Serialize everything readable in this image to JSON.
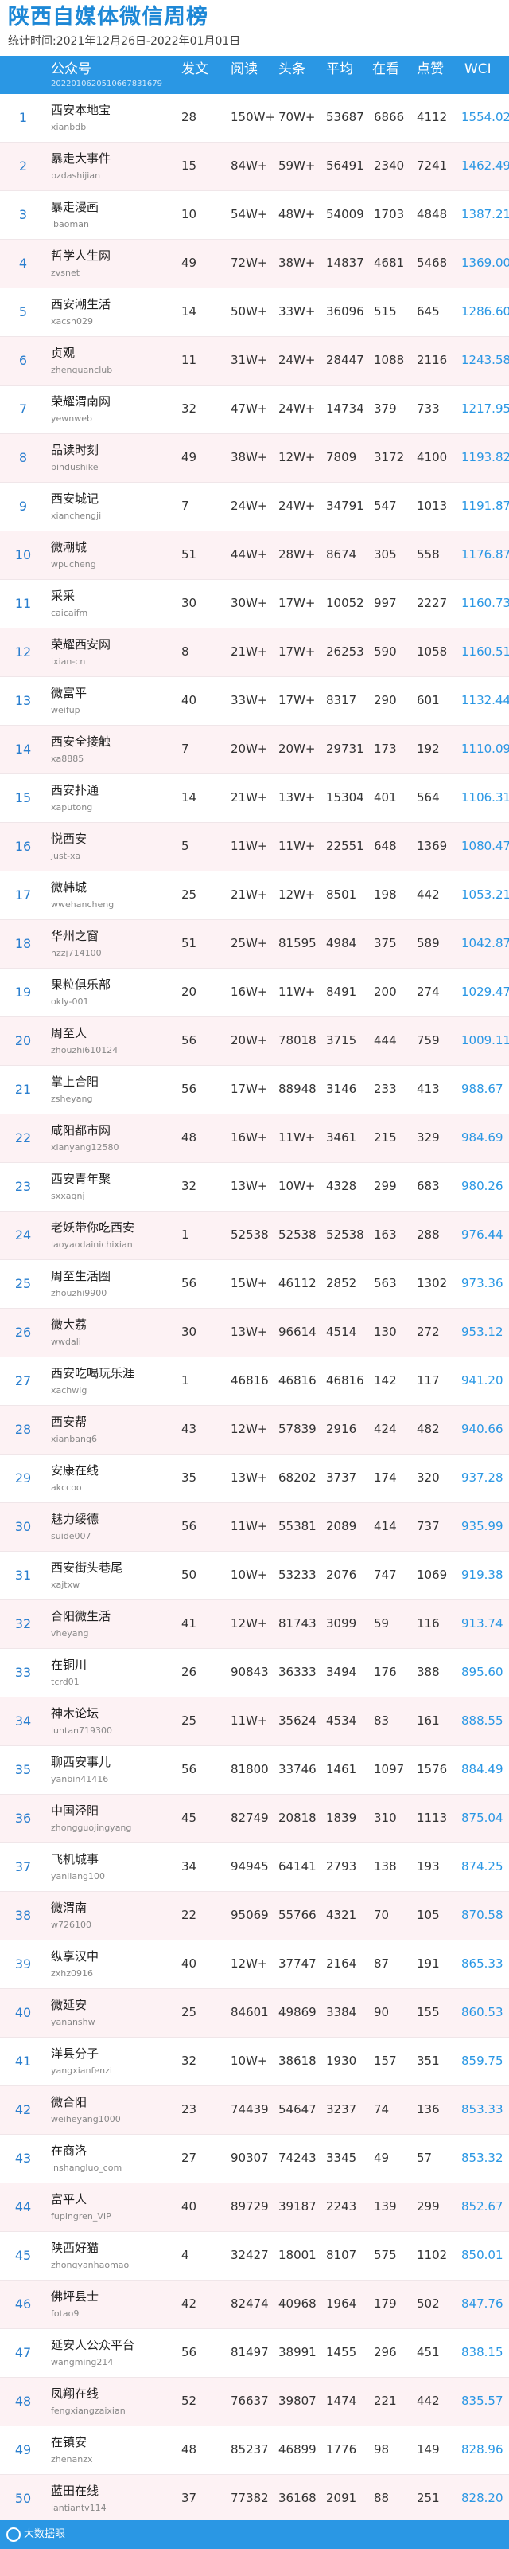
{
  "header": {
    "title": "陕西自媒体微信周榜",
    "period": "统计时间:2021年12月26日-2022年01月01日"
  },
  "table": {
    "columns": [
      "公众号",
      "发文",
      "阅读",
      "头条",
      "平均",
      "在看",
      "点赞",
      "WCI"
    ],
    "subtitle": "2022010620510667831679",
    "rows": [
      {
        "rank": "1",
        "name": "西安本地宝",
        "account": "xianbdb",
        "posts": "28",
        "reads": "150W+",
        "top": "70W+",
        "avg": "53687",
        "watch": "6866",
        "likes": "4112",
        "wci": "1554.02"
      },
      {
        "rank": "2",
        "name": "暴走大事件",
        "account": "bzdashijian",
        "posts": "15",
        "reads": "84W+",
        "top": "59W+",
        "avg": "56491",
        "watch": "2340",
        "likes": "7241",
        "wci": "1462.49"
      },
      {
        "rank": "3",
        "name": "暴走漫画",
        "account": "ibaoman",
        "posts": "10",
        "reads": "54W+",
        "top": "48W+",
        "avg": "54009",
        "watch": "1703",
        "likes": "4848",
        "wci": "1387.21"
      },
      {
        "rank": "4",
        "name": "哲学人生网",
        "account": "zvsnet",
        "posts": "49",
        "reads": "72W+",
        "top": "38W+",
        "avg": "14837",
        "watch": "4681",
        "likes": "5468",
        "wci": "1369.00"
      },
      {
        "rank": "5",
        "name": "西安潮生活",
        "account": "xacsh029",
        "posts": "14",
        "reads": "50W+",
        "top": "33W+",
        "avg": "36096",
        "watch": "515",
        "likes": "645",
        "wci": "1286.60"
      },
      {
        "rank": "6",
        "name": "贞观",
        "account": "zhenguanclub",
        "posts": "11",
        "reads": "31W+",
        "top": "24W+",
        "avg": "28447",
        "watch": "1088",
        "likes": "2116",
        "wci": "1243.58"
      },
      {
        "rank": "7",
        "name": "荣耀渭南网",
        "account": "yewnweb",
        "posts": "32",
        "reads": "47W+",
        "top": "24W+",
        "avg": "14734",
        "watch": "379",
        "likes": "733",
        "wci": "1217.95"
      },
      {
        "rank": "8",
        "name": "品读时刻",
        "account": "pindushike",
        "posts": "49",
        "reads": "38W+",
        "top": "12W+",
        "avg": "7809",
        "watch": "3172",
        "likes": "4100",
        "wci": "1193.82"
      },
      {
        "rank": "9",
        "name": "西安城记",
        "account": "xianchengji",
        "posts": "7",
        "reads": "24W+",
        "top": "24W+",
        "avg": "34791",
        "watch": "547",
        "likes": "1013",
        "wci": "1191.87"
      },
      {
        "rank": "10",
        "name": "微潮城",
        "account": "wpucheng",
        "posts": "51",
        "reads": "44W+",
        "top": "28W+",
        "avg": "8674",
        "watch": "305",
        "likes": "558",
        "wci": "1176.87"
      },
      {
        "rank": "11",
        "name": "采采",
        "account": "caicaifm",
        "posts": "30",
        "reads": "30W+",
        "top": "17W+",
        "avg": "10052",
        "watch": "997",
        "likes": "2227",
        "wci": "1160.73"
      },
      {
        "rank": "12",
        "name": "荣耀西安网",
        "account": "ixian-cn",
        "posts": "8",
        "reads": "21W+",
        "top": "17W+",
        "avg": "26253",
        "watch": "590",
        "likes": "1058",
        "wci": "1160.51"
      },
      {
        "rank": "13",
        "name": "微富平",
        "account": "weifup",
        "posts": "40",
        "reads": "33W+",
        "top": "17W+",
        "avg": "8317",
        "watch": "290",
        "likes": "601",
        "wci": "1132.44"
      },
      {
        "rank": "14",
        "name": "西安全接触",
        "account": "xa8885",
        "posts": "7",
        "reads": "20W+",
        "top": "20W+",
        "avg": "29731",
        "watch": "173",
        "likes": "192",
        "wci": "1110.09"
      },
      {
        "rank": "15",
        "name": "西安扑通",
        "account": "xaputong",
        "posts": "14",
        "reads": "21W+",
        "top": "13W+",
        "avg": "15304",
        "watch": "401",
        "likes": "564",
        "wci": "1106.31"
      },
      {
        "rank": "16",
        "name": "悦西安",
        "account": "just-xa",
        "posts": "5",
        "reads": "11W+",
        "top": "11W+",
        "avg": "22551",
        "watch": "648",
        "likes": "1369",
        "wci": "1080.47"
      },
      {
        "rank": "17",
        "name": "微韩城",
        "account": "wwehancheng",
        "posts": "25",
        "reads": "21W+",
        "top": "12W+",
        "avg": "8501",
        "watch": "198",
        "likes": "442",
        "wci": "1053.21"
      },
      {
        "rank": "18",
        "name": "华州之窗",
        "account": "hzzj714100",
        "posts": "51",
        "reads": "25W+",
        "top": "81595",
        "avg": "4984",
        "watch": "375",
        "likes": "589",
        "wci": "1042.87"
      },
      {
        "rank": "19",
        "name": "果粒俱乐部",
        "account": "okly-001",
        "posts": "20",
        "reads": "16W+",
        "top": "11W+",
        "avg": "8491",
        "watch": "200",
        "likes": "274",
        "wci": "1029.47"
      },
      {
        "rank": "20",
        "name": "周至人",
        "account": "zhouzhi610124",
        "posts": "56",
        "reads": "20W+",
        "top": "78018",
        "avg": "3715",
        "watch": "444",
        "likes": "759",
        "wci": "1009.11"
      },
      {
        "rank": "21",
        "name": "掌上合阳",
        "account": "zsheyang",
        "posts": "56",
        "reads": "17W+",
        "top": "88948",
        "avg": "3146",
        "watch": "233",
        "likes": "413",
        "wci": "988.67"
      },
      {
        "rank": "22",
        "name": "咸阳都市网",
        "account": "xianyang12580",
        "posts": "48",
        "reads": "16W+",
        "top": "11W+",
        "avg": "3461",
        "watch": "215",
        "likes": "329",
        "wci": "984.69"
      },
      {
        "rank": "23",
        "name": "西安青年聚",
        "account": "sxxaqnj",
        "posts": "32",
        "reads": "13W+",
        "top": "10W+",
        "avg": "4328",
        "watch": "299",
        "likes": "683",
        "wci": "980.26"
      },
      {
        "rank": "24",
        "name": "老妖带你吃西安",
        "account": "laoyaodainichixian",
        "posts": "1",
        "reads": "52538",
        "top": "52538",
        "avg": "52538",
        "watch": "163",
        "likes": "288",
        "wci": "976.44"
      },
      {
        "rank": "25",
        "name": "周至生活圈",
        "account": "zhouzhi9900",
        "posts": "56",
        "reads": "15W+",
        "top": "46112",
        "avg": "2852",
        "watch": "563",
        "likes": "1302",
        "wci": "973.36"
      },
      {
        "rank": "26",
        "name": "微大荔",
        "account": "wwdali",
        "posts": "30",
        "reads": "13W+",
        "top": "96614",
        "avg": "4514",
        "watch": "130",
        "likes": "272",
        "wci": "953.12"
      },
      {
        "rank": "27",
        "name": "西安吃喝玩乐涯",
        "account": "xachwlg",
        "posts": "1",
        "reads": "46816",
        "top": "46816",
        "avg": "46816",
        "watch": "142",
        "likes": "117",
        "wci": "941.20"
      },
      {
        "rank": "28",
        "name": "西安帮",
        "account": "xianbang6",
        "posts": "43",
        "reads": "12W+",
        "top": "57839",
        "avg": "2916",
        "watch": "424",
        "likes": "482",
        "wci": "940.66"
      },
      {
        "rank": "29",
        "name": "安康在线",
        "account": "akccoo",
        "posts": "35",
        "reads": "13W+",
        "top": "68202",
        "avg": "3737",
        "watch": "174",
        "likes": "320",
        "wci": "937.28"
      },
      {
        "rank": "30",
        "name": "魅力绥德",
        "account": "suide007",
        "posts": "56",
        "reads": "11W+",
        "top": "55381",
        "avg": "2089",
        "watch": "414",
        "likes": "737",
        "wci": "935.99"
      },
      {
        "rank": "31",
        "name": "西安街头巷尾",
        "account": "xajtxw",
        "posts": "50",
        "reads": "10W+",
        "top": "53233",
        "avg": "2076",
        "watch": "747",
        "likes": "1069",
        "wci": "919.38"
      },
      {
        "rank": "32",
        "name": "合阳微生活",
        "account": "vheyang",
        "posts": "41",
        "reads": "12W+",
        "top": "81743",
        "avg": "3099",
        "watch": "59",
        "likes": "116",
        "wci": "913.74"
      },
      {
        "rank": "33",
        "name": "在铜川",
        "account": "tcrd01",
        "posts": "26",
        "reads": "90843",
        "top": "36333",
        "avg": "3494",
        "watch": "176",
        "likes": "388",
        "wci": "895.60"
      },
      {
        "rank": "34",
        "name": "神木论坛",
        "account": "luntan719300",
        "posts": "25",
        "reads": "11W+",
        "top": "35624",
        "avg": "4534",
        "watch": "83",
        "likes": "161",
        "wci": "888.55"
      },
      {
        "rank": "35",
        "name": "聊西安事儿",
        "account": "yanbin41416",
        "posts": "56",
        "reads": "81800",
        "top": "33746",
        "avg": "1461",
        "watch": "1097",
        "likes": "1576",
        "wci": "884.49"
      },
      {
        "rank": "36",
        "name": "中国泾阳",
        "account": "zhongguojingyang",
        "posts": "45",
        "reads": "82749",
        "top": "20818",
        "avg": "1839",
        "watch": "310",
        "likes": "1113",
        "wci": "875.04"
      },
      {
        "rank": "37",
        "name": "飞机城事",
        "account": "yanliang100",
        "posts": "34",
        "reads": "94945",
        "top": "64141",
        "avg": "2793",
        "watch": "138",
        "likes": "193",
        "wci": "874.25"
      },
      {
        "rank": "38",
        "name": "微渭南",
        "account": "w726100",
        "posts": "22",
        "reads": "95069",
        "top": "55766",
        "avg": "4321",
        "watch": "70",
        "likes": "105",
        "wci": "870.58"
      },
      {
        "rank": "39",
        "name": "纵享汉中",
        "account": "zxhz0916",
        "posts": "40",
        "reads": "12W+",
        "top": "37747",
        "avg": "2164",
        "watch": "87",
        "likes": "191",
        "wci": "865.33"
      },
      {
        "rank": "40",
        "name": "微延安",
        "account": "yananshw",
        "posts": "25",
        "reads": "84601",
        "top": "49869",
        "avg": "3384",
        "watch": "90",
        "likes": "155",
        "wci": "860.53"
      },
      {
        "rank": "41",
        "name": "洋县分子",
        "account": "yangxianfenzi",
        "posts": "32",
        "reads": "10W+",
        "top": "38618",
        "avg": "1930",
        "watch": "157",
        "likes": "351",
        "wci": "859.75"
      },
      {
        "rank": "42",
        "name": "微合阳",
        "account": "weiheyang1000",
        "posts": "23",
        "reads": "74439",
        "top": "54647",
        "avg": "3237",
        "watch": "74",
        "likes": "136",
        "wci": "853.33"
      },
      {
        "rank": "43",
        "name": "在商洛",
        "account": "inshangluo_com",
        "posts": "27",
        "reads": "90307",
        "top": "74243",
        "avg": "3345",
        "watch": "49",
        "likes": "57",
        "wci": "853.32"
      },
      {
        "rank": "44",
        "name": "富平人",
        "account": "fupingren_VIP",
        "posts": "40",
        "reads": "89729",
        "top": "39187",
        "avg": "2243",
        "watch": "139",
        "likes": "299",
        "wci": "852.67"
      },
      {
        "rank": "45",
        "name": "陕西好猫",
        "account": "zhongyanhaomao",
        "posts": "4",
        "reads": "32427",
        "top": "18001",
        "avg": "8107",
        "watch": "575",
        "likes": "1102",
        "wci": "850.01"
      },
      {
        "rank": "46",
        "name": "佛坪县士",
        "account": "fotao9",
        "posts": "42",
        "reads": "82474",
        "top": "40968",
        "avg": "1964",
        "watch": "179",
        "likes": "502",
        "wci": "847.76"
      },
      {
        "rank": "47",
        "name": "延安人公众平台",
        "account": "wangming214",
        "posts": "56",
        "reads": "81497",
        "top": "38991",
        "avg": "1455",
        "watch": "296",
        "likes": "451",
        "wci": "838.15"
      },
      {
        "rank": "48",
        "name": "凤翔在线",
        "account": "fengxiangzaixian",
        "posts": "52",
        "reads": "76637",
        "top": "39807",
        "avg": "1474",
        "watch": "221",
        "likes": "442",
        "wci": "835.57"
      },
      {
        "rank": "49",
        "name": "在镇安",
        "account": "zhenanzx",
        "posts": "48",
        "reads": "85237",
        "top": "46899",
        "avg": "1776",
        "watch": "98",
        "likes": "149",
        "wci": "828.96"
      },
      {
        "rank": "50",
        "name": "蓝田在线",
        "account": "lantiantv114",
        "posts": "37",
        "reads": "77382",
        "top": "36168",
        "avg": "2091",
        "watch": "88",
        "likes": "251",
        "wci": "828.20"
      }
    ]
  },
  "footer": {
    "logo_text": "大数据眼",
    "logo_icon": "eye-logo-icon"
  },
  "colors": {
    "accent": "#2a97e4",
    "title": "#1e88d6",
    "stripe": "#fdf2f4"
  }
}
